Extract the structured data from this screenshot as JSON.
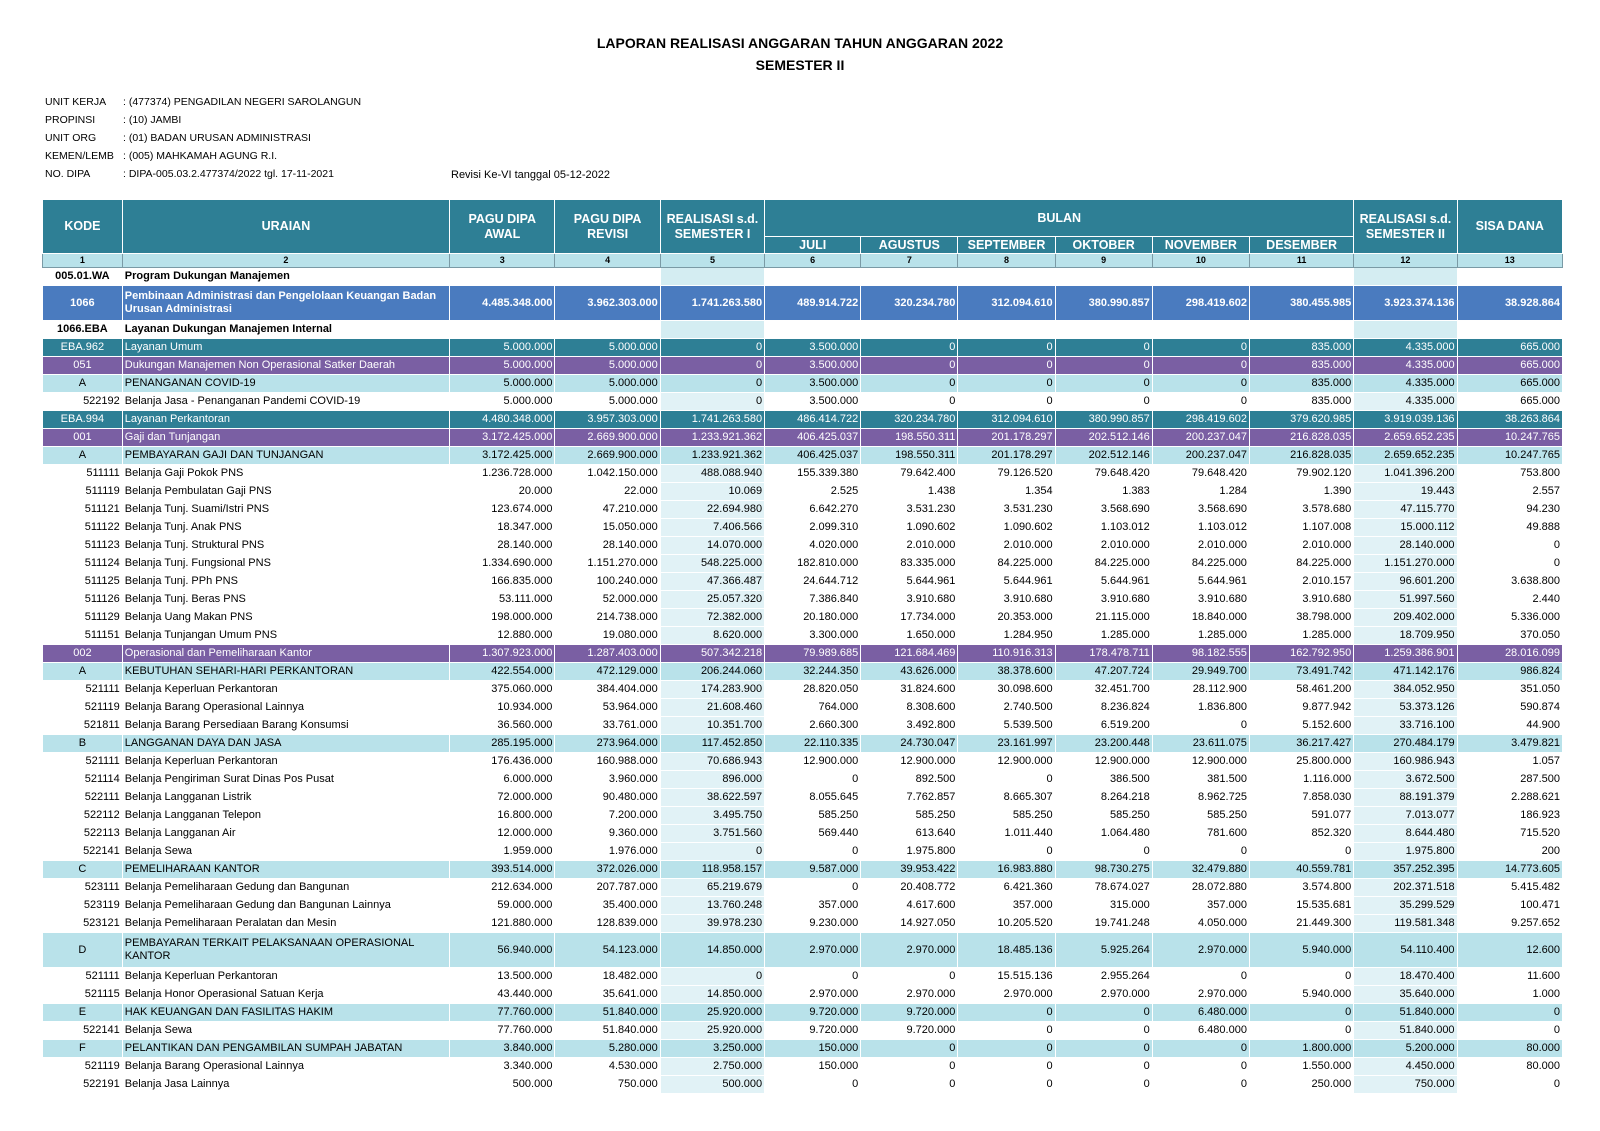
{
  "header": {
    "title": "LAPORAN REALISASI ANGGARAN TAHUN ANGGARAN 2022",
    "subtitle": "SEMESTER II"
  },
  "meta": [
    {
      "label": "UNIT KERJA",
      "value": ": (477374) PENGADILAN NEGERI SAROLANGUN"
    },
    {
      "label": "PROPINSI",
      "value": ": (10) JAMBI"
    },
    {
      "label": "UNIT ORG",
      "value": ": (01) BADAN URUSAN ADMINISTRASI"
    },
    {
      "label": "KEMEN/LEMB",
      "value": ": (005) MAHKAMAH AGUNG R.I."
    },
    {
      "label": "NO. DIPA",
      "value": ": DIPA-005.03.2.477374/2022 tgl. 17-11-2021"
    }
  ],
  "revisi": "Revisi Ke-VI tanggal 05-12-2022",
  "table": {
    "headers": {
      "kode": "KODE",
      "uraian": "URAIAN",
      "pagu_awal": "PAGU DIPA AWAL",
      "pagu_revisi": "PAGU DIPA REVISI",
      "real_sem1": "REALISASI s.d. SEMESTER I",
      "bulan": "BULAN",
      "months": [
        "JULI",
        "AGUSTUS",
        "SEPTEMBER",
        "OKTOBER",
        "NOVEMBER",
        "DESEMBER"
      ],
      "real_sem2": "REALISASI s.d. SEMESTER II",
      "sisa": "SISA DANA"
    },
    "col_numbers": [
      "1",
      "2",
      "3",
      "4",
      "5",
      "6",
      "7",
      "8",
      "9",
      "10",
      "11",
      "12",
      "13"
    ],
    "rows": [
      {
        "type": "prog",
        "kode": "005.01.WA",
        "uraian": "Program Dukungan Manajemen",
        "v": [
          "",
          "",
          "",
          "",
          "",
          "",
          "",
          "",
          "",
          "",
          ""
        ]
      },
      {
        "type": "keg",
        "kode": "1066",
        "uraian": "Pembinaan Administrasi dan Pengelolaan Keuangan Badan Urusan Administrasi",
        "v": [
          "4.485.348.000",
          "3.962.303.000",
          "1.741.263.580",
          "489.914.722",
          "320.234.780",
          "312.094.610",
          "380.990.857",
          "298.419.602",
          "380.455.985",
          "3.923.374.136",
          "38.928.864"
        ]
      },
      {
        "type": "prog",
        "kode": "1066.EBA",
        "uraian": "Layanan Dukungan Manajemen Internal",
        "v": [
          "",
          "",
          "",
          "",
          "",
          "",
          "",
          "",
          "",
          "",
          ""
        ]
      },
      {
        "type": "kro",
        "kode": "EBA.962",
        "uraian": "Layanan Umum",
        "v": [
          "5.000.000",
          "5.000.000",
          "0",
          "3.500.000",
          "0",
          "0",
          "0",
          "0",
          "835.000",
          "4.335.000",
          "665.000"
        ]
      },
      {
        "type": "ro",
        "kode": "051",
        "uraian": "Dukungan Manajemen Non Operasional Satker Daerah",
        "v": [
          "5.000.000",
          "5.000.000",
          "0",
          "3.500.000",
          "0",
          "0",
          "0",
          "0",
          "835.000",
          "4.335.000",
          "665.000"
        ]
      },
      {
        "type": "kmp",
        "kode": "A",
        "uraian": "PENANGANAN COVID-19",
        "v": [
          "5.000.000",
          "5.000.000",
          "0",
          "3.500.000",
          "0",
          "0",
          "0",
          "0",
          "835.000",
          "4.335.000",
          "665.000"
        ]
      },
      {
        "type": "akun",
        "kode": "522192",
        "uraian": "Belanja Jasa - Penanganan Pandemi COVID-19",
        "v": [
          "5.000.000",
          "5.000.000",
          "0",
          "3.500.000",
          "0",
          "0",
          "0",
          "0",
          "835.000",
          "4.335.000",
          "665.000"
        ]
      },
      {
        "type": "kro",
        "kode": "EBA.994",
        "uraian": "Layanan Perkantoran",
        "v": [
          "4.480.348.000",
          "3.957.303.000",
          "1.741.263.580",
          "486.414.722",
          "320.234.780",
          "312.094.610",
          "380.990.857",
          "298.419.602",
          "379.620.985",
          "3.919.039.136",
          "38.263.864"
        ]
      },
      {
        "type": "ro",
        "kode": "001",
        "uraian": "Gaji dan Tunjangan",
        "v": [
          "3.172.425.000",
          "2.669.900.000",
          "1.233.921.362",
          "406.425.037",
          "198.550.311",
          "201.178.297",
          "202.512.146",
          "200.237.047",
          "216.828.035",
          "2.659.652.235",
          "10.247.765"
        ]
      },
      {
        "type": "kmp",
        "kode": "A",
        "uraian": "PEMBAYARAN GAJI DAN TUNJANGAN",
        "v": [
          "3.172.425.000",
          "2.669.900.000",
          "1.233.921.362",
          "406.425.037",
          "198.550.311",
          "201.178.297",
          "202.512.146",
          "200.237.047",
          "216.828.035",
          "2.659.652.235",
          "10.247.765"
        ]
      },
      {
        "type": "akun",
        "kode": "511111",
        "uraian": "Belanja Gaji Pokok PNS",
        "v": [
          "1.236.728.000",
          "1.042.150.000",
          "488.088.940",
          "155.339.380",
          "79.642.400",
          "79.126.520",
          "79.648.420",
          "79.648.420",
          "79.902.120",
          "1.041.396.200",
          "753.800"
        ]
      },
      {
        "type": "akun",
        "kode": "511119",
        "uraian": "Belanja Pembulatan Gaji PNS",
        "v": [
          "20.000",
          "22.000",
          "10.069",
          "2.525",
          "1.438",
          "1.354",
          "1.383",
          "1.284",
          "1.390",
          "19.443",
          "2.557"
        ]
      },
      {
        "type": "akun",
        "kode": "511121",
        "uraian": "Belanja Tunj. Suami/Istri PNS",
        "v": [
          "123.674.000",
          "47.210.000",
          "22.694.980",
          "6.642.270",
          "3.531.230",
          "3.531.230",
          "3.568.690",
          "3.568.690",
          "3.578.680",
          "47.115.770",
          "94.230"
        ]
      },
      {
        "type": "akun",
        "kode": "511122",
        "uraian": "Belanja Tunj. Anak PNS",
        "v": [
          "18.347.000",
          "15.050.000",
          "7.406.566",
          "2.099.310",
          "1.090.602",
          "1.090.602",
          "1.103.012",
          "1.103.012",
          "1.107.008",
          "15.000.112",
          "49.888"
        ]
      },
      {
        "type": "akun",
        "kode": "511123",
        "uraian": "Belanja Tunj. Struktural PNS",
        "v": [
          "28.140.000",
          "28.140.000",
          "14.070.000",
          "4.020.000",
          "2.010.000",
          "2.010.000",
          "2.010.000",
          "2.010.000",
          "2.010.000",
          "28.140.000",
          "0"
        ]
      },
      {
        "type": "akun",
        "kode": "511124",
        "uraian": "Belanja Tunj. Fungsional PNS",
        "v": [
          "1.334.690.000",
          "1.151.270.000",
          "548.225.000",
          "182.810.000",
          "83.335.000",
          "84.225.000",
          "84.225.000",
          "84.225.000",
          "84.225.000",
          "1.151.270.000",
          "0"
        ]
      },
      {
        "type": "akun",
        "kode": "511125",
        "uraian": "Belanja Tunj. PPh PNS",
        "v": [
          "166.835.000",
          "100.240.000",
          "47.366.487",
          "24.644.712",
          "5.644.961",
          "5.644.961",
          "5.644.961",
          "5.644.961",
          "2.010.157",
          "96.601.200",
          "3.638.800"
        ]
      },
      {
        "type": "akun",
        "kode": "511126",
        "uraian": "Belanja Tunj. Beras PNS",
        "v": [
          "53.111.000",
          "52.000.000",
          "25.057.320",
          "7.386.840",
          "3.910.680",
          "3.910.680",
          "3.910.680",
          "3.910.680",
          "3.910.680",
          "51.997.560",
          "2.440"
        ]
      },
      {
        "type": "akun",
        "kode": "511129",
        "uraian": "Belanja Uang Makan PNS",
        "v": [
          "198.000.000",
          "214.738.000",
          "72.382.000",
          "20.180.000",
          "17.734.000",
          "20.353.000",
          "21.115.000",
          "18.840.000",
          "38.798.000",
          "209.402.000",
          "5.336.000"
        ]
      },
      {
        "type": "akun",
        "kode": "511151",
        "uraian": "Belanja Tunjangan Umum PNS",
        "v": [
          "12.880.000",
          "19.080.000",
          "8.620.000",
          "3.300.000",
          "1.650.000",
          "1.284.950",
          "1.285.000",
          "1.285.000",
          "1.285.000",
          "18.709.950",
          "370.050"
        ]
      },
      {
        "type": "ro",
        "kode": "002",
        "uraian": "Operasional dan Pemeliharaan Kantor",
        "v": [
          "1.307.923.000",
          "1.287.403.000",
          "507.342.218",
          "79.989.685",
          "121.684.469",
          "110.916.313",
          "178.478.711",
          "98.182.555",
          "162.792.950",
          "1.259.386.901",
          "28.016.099"
        ]
      },
      {
        "type": "kmp",
        "kode": "A",
        "uraian": "KEBUTUHAN SEHARI-HARI PERKANTORAN",
        "v": [
          "422.554.000",
          "472.129.000",
          "206.244.060",
          "32.244.350",
          "43.626.000",
          "38.378.600",
          "47.207.724",
          "29.949.700",
          "73.491.742",
          "471.142.176",
          "986.824"
        ]
      },
      {
        "type": "akun",
        "kode": "521111",
        "uraian": "Belanja Keperluan Perkantoran",
        "v": [
          "375.060.000",
          "384.404.000",
          "174.283.900",
          "28.820.050",
          "31.824.600",
          "30.098.600",
          "32.451.700",
          "28.112.900",
          "58.461.200",
          "384.052.950",
          "351.050"
        ]
      },
      {
        "type": "akun",
        "kode": "521119",
        "uraian": "Belanja Barang Operasional Lainnya",
        "v": [
          "10.934.000",
          "53.964.000",
          "21.608.460",
          "764.000",
          "8.308.600",
          "2.740.500",
          "8.236.824",
          "1.836.800",
          "9.877.942",
          "53.373.126",
          "590.874"
        ]
      },
      {
        "type": "akun",
        "kode": "521811",
        "uraian": "Belanja Barang Persediaan Barang Konsumsi",
        "v": [
          "36.560.000",
          "33.761.000",
          "10.351.700",
          "2.660.300",
          "3.492.800",
          "5.539.500",
          "6.519.200",
          "0",
          "5.152.600",
          "33.716.100",
          "44.900"
        ]
      },
      {
        "type": "kmp",
        "kode": "B",
        "uraian": "LANGGANAN DAYA DAN JASA",
        "v": [
          "285.195.000",
          "273.964.000",
          "117.452.850",
          "22.110.335",
          "24.730.047",
          "23.161.997",
          "23.200.448",
          "23.611.075",
          "36.217.427",
          "270.484.179",
          "3.479.821"
        ]
      },
      {
        "type": "akun",
        "kode": "521111",
        "uraian": "Belanja Keperluan Perkantoran",
        "v": [
          "176.436.000",
          "160.988.000",
          "70.686.943",
          "12.900.000",
          "12.900.000",
          "12.900.000",
          "12.900.000",
          "12.900.000",
          "25.800.000",
          "160.986.943",
          "1.057"
        ]
      },
      {
        "type": "akun",
        "kode": "521114",
        "uraian": "Belanja Pengiriman Surat Dinas Pos Pusat",
        "v": [
          "6.000.000",
          "3.960.000",
          "896.000",
          "0",
          "892.500",
          "0",
          "386.500",
          "381.500",
          "1.116.000",
          "3.672.500",
          "287.500"
        ]
      },
      {
        "type": "akun",
        "kode": "522111",
        "uraian": "Belanja Langganan Listrik",
        "v": [
          "72.000.000",
          "90.480.000",
          "38.622.597",
          "8.055.645",
          "7.762.857",
          "8.665.307",
          "8.264.218",
          "8.962.725",
          "7.858.030",
          "88.191.379",
          "2.288.621"
        ]
      },
      {
        "type": "akun",
        "kode": "522112",
        "uraian": "Belanja Langganan Telepon",
        "v": [
          "16.800.000",
          "7.200.000",
          "3.495.750",
          "585.250",
          "585.250",
          "585.250",
          "585.250",
          "585.250",
          "591.077",
          "7.013.077",
          "186.923"
        ]
      },
      {
        "type": "akun",
        "kode": "522113",
        "uraian": "Belanja Langganan Air",
        "v": [
          "12.000.000",
          "9.360.000",
          "3.751.560",
          "569.440",
          "613.640",
          "1.011.440",
          "1.064.480",
          "781.600",
          "852.320",
          "8.644.480",
          "715.520"
        ]
      },
      {
        "type": "akun",
        "kode": "522141",
        "uraian": "Belanja Sewa",
        "v": [
          "1.959.000",
          "1.976.000",
          "0",
          "0",
          "1.975.800",
          "0",
          "0",
          "0",
          "0",
          "1.975.800",
          "200"
        ]
      },
      {
        "type": "kmp",
        "kode": "C",
        "uraian": "PEMELIHARAAN KANTOR",
        "v": [
          "393.514.000",
          "372.026.000",
          "118.958.157",
          "9.587.000",
          "39.953.422",
          "16.983.880",
          "98.730.275",
          "32.479.880",
          "40.559.781",
          "357.252.395",
          "14.773.605"
        ]
      },
      {
        "type": "akun",
        "kode": "523111",
        "uraian": "Belanja Pemeliharaan Gedung dan Bangunan",
        "v": [
          "212.634.000",
          "207.787.000",
          "65.219.679",
          "0",
          "20.408.772",
          "6.421.360",
          "78.674.027",
          "28.072.880",
          "3.574.800",
          "202.371.518",
          "5.415.482"
        ]
      },
      {
        "type": "akun",
        "kode": "523119",
        "uraian": "Belanja Pemeliharaan Gedung dan Bangunan Lainnya",
        "v": [
          "59.000.000",
          "35.400.000",
          "13.760.248",
          "357.000",
          "4.617.600",
          "357.000",
          "315.000",
          "357.000",
          "15.535.681",
          "35.299.529",
          "100.471"
        ]
      },
      {
        "type": "akun",
        "kode": "523121",
        "uraian": "Belanja Pemeliharaan Peralatan dan Mesin",
        "v": [
          "121.880.000",
          "128.839.000",
          "39.978.230",
          "9.230.000",
          "14.927.050",
          "10.205.520",
          "19.741.248",
          "4.050.000",
          "21.449.300",
          "119.581.348",
          "9.257.652"
        ]
      },
      {
        "type": "kmp",
        "tall": true,
        "kode": "D",
        "uraian": "PEMBAYARAN TERKAIT PELAKSANAAN OPERASIONAL KANTOR",
        "v": [
          "56.940.000",
          "54.123.000",
          "14.850.000",
          "2.970.000",
          "2.970.000",
          "18.485.136",
          "5.925.264",
          "2.970.000",
          "5.940.000",
          "54.110.400",
          "12.600"
        ]
      },
      {
        "type": "akun",
        "kode": "521111",
        "uraian": "Belanja Keperluan Perkantoran",
        "v": [
          "13.500.000",
          "18.482.000",
          "0",
          "0",
          "0",
          "15.515.136",
          "2.955.264",
          "0",
          "0",
          "18.470.400",
          "11.600"
        ]
      },
      {
        "type": "akun",
        "kode": "521115",
        "uraian": "Belanja Honor Operasional Satuan Kerja",
        "v": [
          "43.440.000",
          "35.641.000",
          "14.850.000",
          "2.970.000",
          "2.970.000",
          "2.970.000",
          "2.970.000",
          "2.970.000",
          "5.940.000",
          "35.640.000",
          "1.000"
        ]
      },
      {
        "type": "kmp",
        "kode": "E",
        "uraian": "HAK KEUANGAN DAN FASILITAS HAKIM",
        "v": [
          "77.760.000",
          "51.840.000",
          "25.920.000",
          "9.720.000",
          "9.720.000",
          "0",
          "0",
          "6.480.000",
          "0",
          "51.840.000",
          "0"
        ]
      },
      {
        "type": "akun",
        "kode": "522141",
        "uraian": "Belanja Sewa",
        "v": [
          "77.760.000",
          "51.840.000",
          "25.920.000",
          "9.720.000",
          "9.720.000",
          "0",
          "0",
          "6.480.000",
          "0",
          "51.840.000",
          "0"
        ]
      },
      {
        "type": "kmp",
        "kode": "F",
        "uraian": "PELANTIKAN DAN PENGAMBILAN SUMPAH JABATAN",
        "v": [
          "3.840.000",
          "5.280.000",
          "3.250.000",
          "150.000",
          "0",
          "0",
          "0",
          "0",
          "1.800.000",
          "5.200.000",
          "80.000"
        ]
      },
      {
        "type": "akun",
        "kode": "521119",
        "uraian": "Belanja Barang Operasional Lainnya",
        "v": [
          "3.340.000",
          "4.530.000",
          "2.750.000",
          "150.000",
          "0",
          "0",
          "0",
          "0",
          "1.550.000",
          "4.450.000",
          "80.000"
        ]
      },
      {
        "type": "akun",
        "kode": "522191",
        "uraian": "Belanja Jasa Lainnya",
        "v": [
          "500.000",
          "750.000",
          "500.000",
          "0",
          "0",
          "0",
          "0",
          "0",
          "250.000",
          "750.000",
          "0"
        ]
      }
    ]
  }
}
